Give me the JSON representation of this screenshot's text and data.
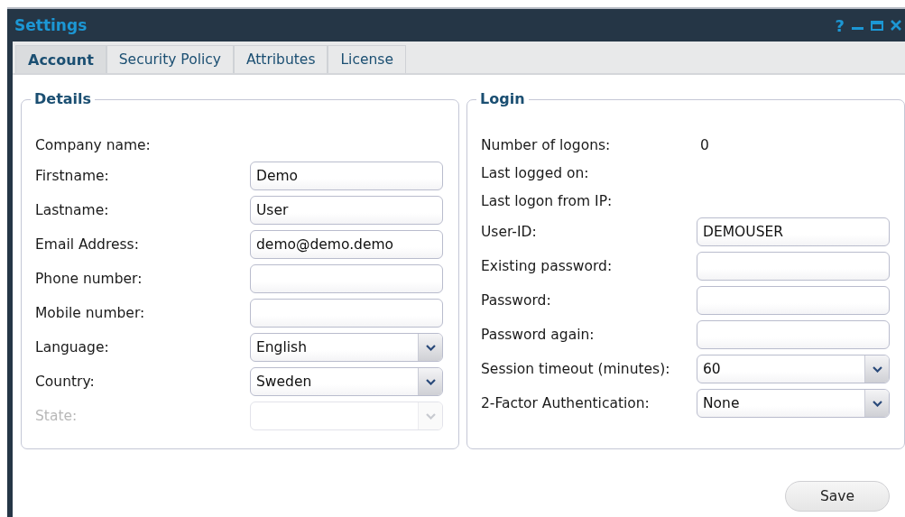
{
  "window": {
    "title": "Settings",
    "controls": [
      "?"
    ]
  },
  "tabs": [
    {
      "label": "Account",
      "selected": true
    },
    {
      "label": "Security Policy",
      "selected": false
    },
    {
      "label": "Attributes",
      "selected": false
    },
    {
      "label": "License",
      "selected": false
    }
  ],
  "details": {
    "legend": "Details",
    "fields": [
      {
        "label": "Company name:",
        "kind": "info",
        "disabled": false
      },
      {
        "label": "Firstname:",
        "kind": "text",
        "value": "Demo",
        "disabled": false
      },
      {
        "label": "Lastname:",
        "kind": "text",
        "value": "User",
        "disabled": false
      },
      {
        "label": "Email Address:",
        "kind": "text",
        "value": "demo@demo.demo",
        "disabled": false
      },
      {
        "label": "Phone number:",
        "kind": "text",
        "disabled": false
      },
      {
        "label": "Mobile number:",
        "kind": "text",
        "disabled": false
      },
      {
        "label": "Language:",
        "kind": "select",
        "value": "English",
        "disabled": false
      },
      {
        "label": "Country:",
        "kind": "select",
        "value": "Sweden",
        "disabled": false
      },
      {
        "label": "State:",
        "kind": "select",
        "disabled": true
      }
    ]
  },
  "login": {
    "legend": "Login",
    "fields": [
      {
        "label": "Number of logons:",
        "kind": "info",
        "value": "0",
        "disabled": false
      },
      {
        "label": "Last logged on:",
        "kind": "info",
        "disabled": false
      },
      {
        "label": "Last logon from IP:",
        "kind": "info",
        "disabled": false
      },
      {
        "label": "User-ID:",
        "kind": "text",
        "value": "DEMOUSER",
        "disabled": false
      },
      {
        "label": "Existing password:",
        "kind": "text",
        "disabled": false
      },
      {
        "label": "Password:",
        "kind": "text",
        "disabled": false
      },
      {
        "label": "Password again:",
        "kind": "text",
        "disabled": false
      },
      {
        "label": "Session timeout (minutes):",
        "kind": "select",
        "value": "60",
        "disabled": false
      },
      {
        "label": "2-Factor Authentication:",
        "kind": "select",
        "value": "None",
        "disabled": false
      }
    ]
  },
  "save_button": "Save"
}
